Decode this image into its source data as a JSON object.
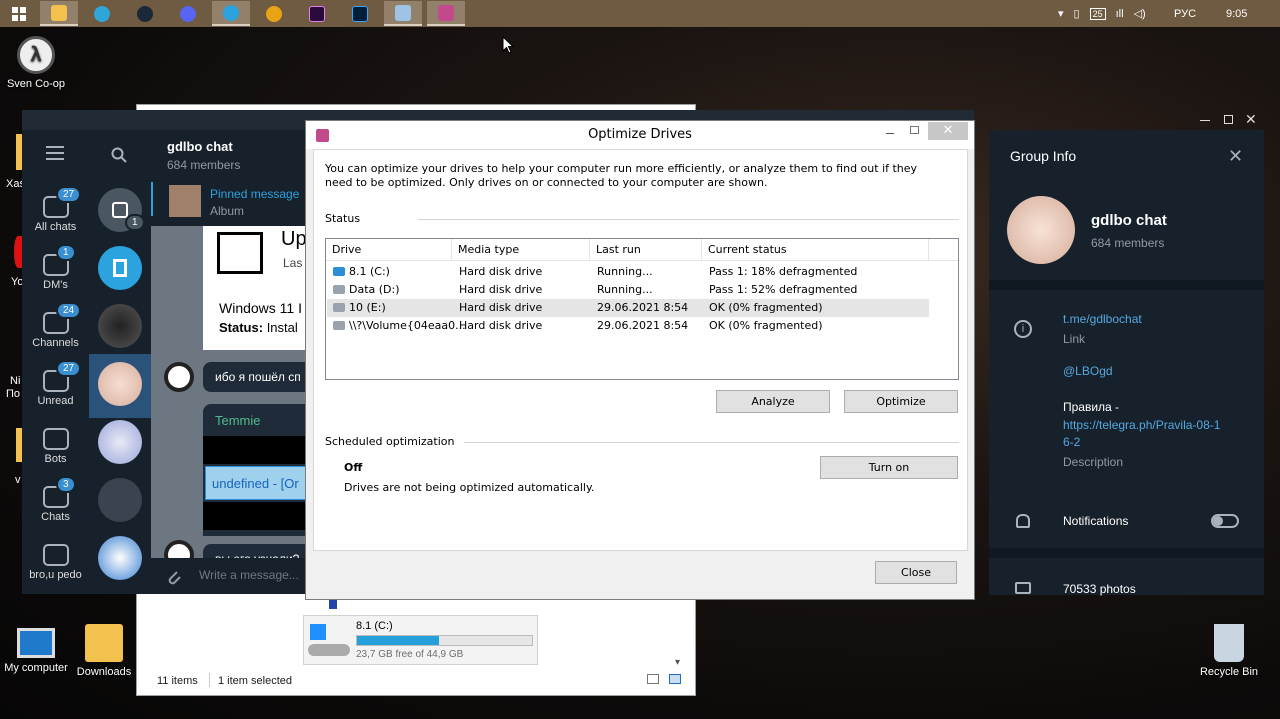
{
  "taskbar": {
    "lang": "РУС",
    "time": "9:05",
    "battery": "25",
    "apps": [
      "windows-start",
      "file-explorer",
      "edge",
      "steam",
      "discord",
      "telegram",
      "winamp",
      "premiere",
      "photoshop",
      "control-panel",
      "optimize-drives"
    ]
  },
  "desktop": {
    "icons": [
      "Sven Co-op",
      "My computer",
      "Downloads",
      "Recycle Bin"
    ],
    "partial": [
      "Xas",
      "Yo",
      "Ni",
      "По",
      "v"
    ]
  },
  "explorer": {
    "drive_label": "8.1 (C:)",
    "free_text": "23,7 GB free of 44,9 GB",
    "fill": 0.47,
    "items": "11 items",
    "selected": "1 item selected"
  },
  "telegram": {
    "folders": [
      {
        "label": "All chats",
        "badge": "27"
      },
      {
        "label": "DM's",
        "badge": "1"
      },
      {
        "label": "Channels",
        "badge": "24"
      },
      {
        "label": "Unread",
        "badge": "27"
      },
      {
        "label": "Bots",
        "badge": ""
      },
      {
        "label": "Chats",
        "badge": "3"
      },
      {
        "label": "bro,u pedo",
        "badge": ""
      }
    ],
    "archive_badge": "1",
    "chat": {
      "title": "gdlbo chat",
      "members": "684 members",
      "pinned_title": "Pinned message",
      "pinned_sub": "Album",
      "card_title": "Up",
      "card_sub": "Las",
      "card_line1": "Windows 11 I",
      "card_line2_bold": "Status:",
      "card_line2": "Instal",
      "msg1": "ибо я пошёл сп",
      "sender": "Temmie",
      "link": "undefined - [Or",
      "msg2": "вы его узнали?",
      "input_placeholder": "Write a message..."
    },
    "info": {
      "header": "Group Info",
      "name": "gdlbo chat",
      "members": "684 members",
      "link": "t.me/gdlbochat",
      "link_label": "Link",
      "username": "@LBOgd",
      "rules_label": "Правила -",
      "rules_url_1": "https://telegra.ph/Pravila-08-1",
      "rules_url_2": "6-2",
      "desc_label": "Description",
      "notifications": "Notifications",
      "photos": "70533 photos"
    }
  },
  "optimize": {
    "title": "Optimize Drives",
    "intro": "You can optimize your drives to help your computer run more efficiently, or analyze them to find out if they need to be optimized. Only drives on or connected to your computer are shown.",
    "status_label": "Status",
    "columns": [
      "Drive",
      "Media type",
      "Last run",
      "Current status"
    ],
    "rows": [
      {
        "drive": "8.1 (C:)",
        "media": "Hard disk drive",
        "last": "Running...",
        "status": "Pass 1: 18% defragmented"
      },
      {
        "drive": "Data (D:)",
        "media": "Hard disk drive",
        "last": "Running...",
        "status": "Pass 1: 52% defragmented"
      },
      {
        "drive": "10 (E:)",
        "media": "Hard disk drive",
        "last": "29.06.2021 8:54",
        "status": "OK (0% fragmented)"
      },
      {
        "drive": "\\\\?\\Volume{04eaa0...",
        "media": "Hard disk drive",
        "last": "29.06.2021 8:54",
        "status": "OK (0% fragmented)"
      }
    ],
    "analyze": "Analyze",
    "optimize": "Optimize",
    "sched_label": "Scheduled optimization",
    "sched_state": "Off",
    "sched_desc": "Drives are not being optimized automatically.",
    "turn_on": "Turn on",
    "close": "Close"
  }
}
